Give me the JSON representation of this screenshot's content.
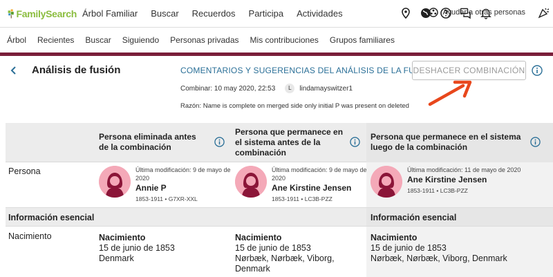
{
  "brand": {
    "name": "FamilySearch",
    "color": "#8bbd3f"
  },
  "top_nav": [
    "Árbol Familiar",
    "Buscar",
    "Recuerdos",
    "Participa",
    "Actividades"
  ],
  "top_icons": [
    "map-pin-icon",
    "globe-icon",
    "help-icon",
    "chat-icon",
    "bell-icon"
  ],
  "sub_nav": [
    "Árbol",
    "Recientes",
    "Buscar",
    "Siguiendo",
    "Personas privadas",
    "Mis contribuciones",
    "Grupos familiares"
  ],
  "help_others": "Ayudar a otras personas",
  "accent": "#7a1e3a",
  "page": {
    "title": "Análisis de fusión",
    "comments_link": "COMENTARIOS Y SUGERENCIAS DEL ANÁLISIS DE LA FUSIÓN",
    "undo_button": "DESHACER COMBINACIÓN",
    "merged_label": "Combinar: 10 may 2020, 22:53",
    "user_initial": "L",
    "user_name": "lindamayswitzer1",
    "reason": "Razón: Name is complete on merged side only initial P was present on deleted"
  },
  "table": {
    "columns": [
      "Persona eliminada antes de la combinación",
      "Persona que permanece en el sistema antes de la combinación",
      "Persona que permanece en el sistema luego de la combinación"
    ],
    "person_row_label": "Persona",
    "persons": [
      {
        "modified": "Última modificación: 9 de mayo de 2020",
        "name": "Annie P",
        "meta": "1853-1911 • G7XR-XXL"
      },
      {
        "modified": "Última modificación: 9 de mayo de 2020",
        "name": "Ane Kirstine Jensen",
        "meta": "1853-1911 • LC3B-PZZ"
      },
      {
        "modified": "Última modificación: 11 de mayo de 2020",
        "name": "Ane Kirstine Jensen",
        "meta": "1853-1911 • LC3B-PZZ"
      }
    ],
    "section_title": "Información esencial",
    "birth_row_label": "Nacimiento",
    "births": [
      {
        "label": "Nacimiento",
        "date": "15 de junio de 1853",
        "place": "Denmark"
      },
      {
        "label": "Nacimiento",
        "date": "15 de junio de 1853",
        "place": "Nørbæk, Nørbæk, Viborg, Denmark"
      },
      {
        "label": "Nacimiento",
        "date": "15 de junio de 1853",
        "place": "Nørbæk, Nørbæk, Viborg, Denmark"
      }
    ]
  }
}
